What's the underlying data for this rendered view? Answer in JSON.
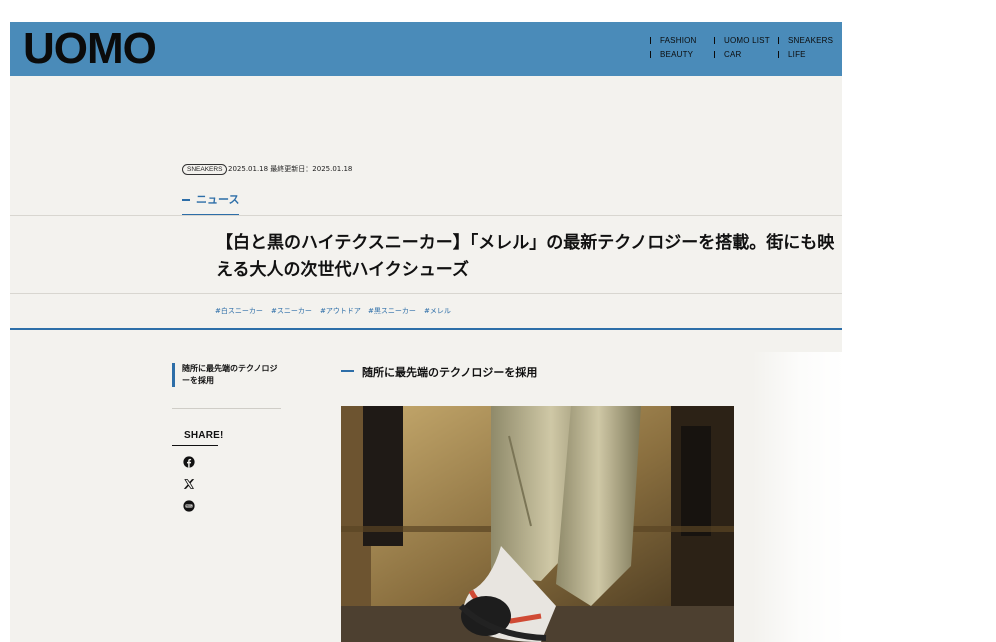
{
  "header": {
    "logo": "UOMO",
    "nav": [
      {
        "label": "FASHION"
      },
      {
        "label": "UOMO LIST"
      },
      {
        "label": "SNEAKERS"
      },
      {
        "label": "BEAUTY"
      },
      {
        "label": "CAR"
      },
      {
        "label": "LIFE"
      }
    ]
  },
  "article": {
    "category_badge": "SNEAKERS",
    "dates": "2025.01.18 最終更新日：2025.01.18",
    "section_label": "ニュース",
    "title": "【白と黒のハイテクスニーカー】「メレル」の最新テクノロジーを搭載。街にも映える大人の次世代ハイクシューズ",
    "tags": [
      "#白スニーカー",
      "#スニーカー",
      "#アウトドア",
      "#黒スニーカー",
      "#メレル"
    ],
    "heading": "随所に最先端のテクノロジーを採用"
  },
  "sidebar": {
    "toc_item": "随所に最先端のテクノロジーを採用",
    "share_label": "SHARE!",
    "share_icons": [
      "facebook-icon",
      "x-icon",
      "line-icon"
    ]
  },
  "colors": {
    "header_bg": "#4a8bb9",
    "page_bg": "#f3f2ee",
    "accent": "#2d6ea8"
  }
}
